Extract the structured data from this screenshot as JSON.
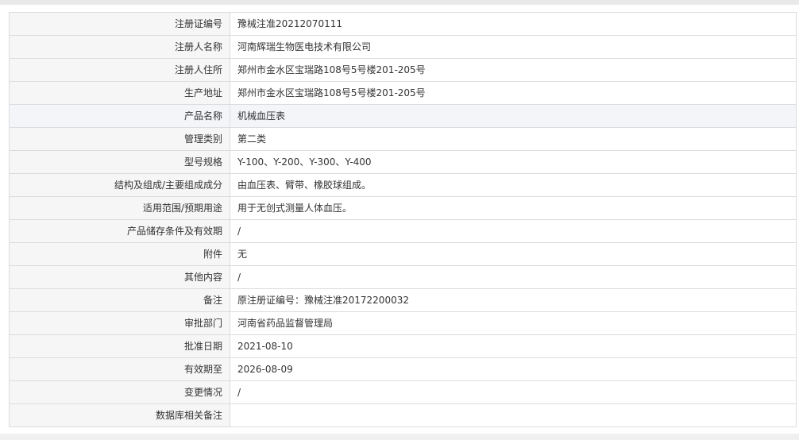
{
  "detail": {
    "rows": [
      {
        "label": "注册证编号",
        "value": "豫械注准20212070111"
      },
      {
        "label": "注册人名称",
        "value": "河南辉瑞生物医电技术有限公司"
      },
      {
        "label": "注册人住所",
        "value": "郑州市金水区宝瑞路108号5号楼201-205号"
      },
      {
        "label": "生产地址",
        "value": "郑州市金水区宝瑞路108号5号楼201-205号"
      },
      {
        "label": "产品名称",
        "value": "机械血压表"
      },
      {
        "label": "管理类别",
        "value": "第二类"
      },
      {
        "label": "型号规格",
        "value": "Y-100、Y-200、Y-300、Y-400"
      },
      {
        "label": "结构及组成/主要组成成分",
        "value": "由血压表、臂带、橡胶球组成。"
      },
      {
        "label": "适用范围/预期用途",
        "value": "用于无创式测量人体血压。"
      },
      {
        "label": "产品储存条件及有效期",
        "value": "/"
      },
      {
        "label": "附件",
        "value": "无"
      },
      {
        "label": "其他内容",
        "value": "/"
      },
      {
        "label": "备注",
        "value": "原注册证编号：豫械注准20172200032"
      },
      {
        "label": "审批部门",
        "value": "河南省药品监督管理局"
      },
      {
        "label": "批准日期",
        "value": "2021-08-10"
      },
      {
        "label": "有效期至",
        "value": "2026-08-09"
      },
      {
        "label": "变更情况",
        "value": "/"
      },
      {
        "label": "数据库相关备注",
        "value": ""
      }
    ]
  }
}
